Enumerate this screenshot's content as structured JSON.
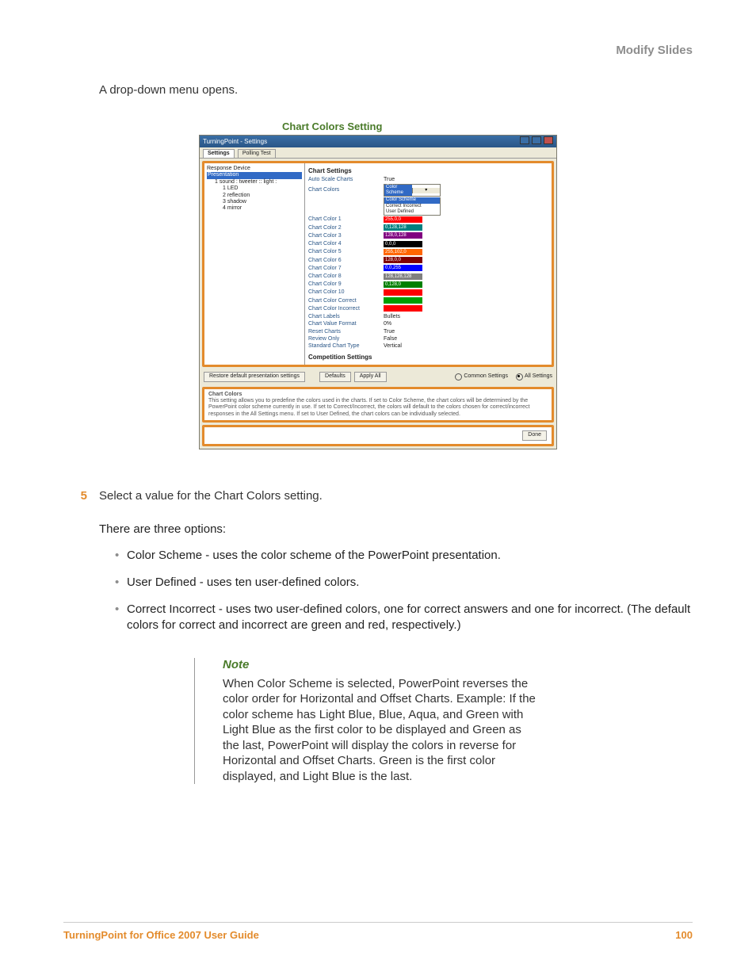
{
  "header": {
    "section": "Modify Slides"
  },
  "intro": "A drop-down menu opens.",
  "caption": "Chart Colors Setting",
  "window": {
    "title": "TurningPoint - Settings",
    "tabs": {
      "settings": "Settings",
      "polling": "Polling Test"
    },
    "tree": {
      "responseDevice": "Response Device",
      "presentation": "Presentation",
      "parent": "1  sound : tweeter :: light :",
      "i1": "1  LED",
      "i2": "2  reflection",
      "i3": "3  shadow",
      "i4": "4  mirror"
    },
    "section1": "Chart Settings",
    "props": {
      "autoScale": {
        "l": "Auto Scale Charts",
        "v": "True"
      },
      "chartColors": {
        "l": "Chart Colors",
        "v": "Color Scheme",
        "opt1": "Color Scheme",
        "opt2": "Correct Incorrect",
        "opt3": "User Defined"
      },
      "c1": {
        "l": "Chart Color 1",
        "v": "255,0,0",
        "bg": "#ff0000"
      },
      "c2": {
        "l": "Chart Color 2",
        "v": "0,128,128",
        "bg": "#008080"
      },
      "c3": {
        "l": "Chart Color 3",
        "v": "128,0,128",
        "bg": "#800080"
      },
      "c4": {
        "l": "Chart Color 4",
        "v": "0,0,0",
        "bg": "#000000"
      },
      "c5": {
        "l": "Chart Color 5",
        "v": "255,102,0",
        "bg": "#ff6600"
      },
      "c6": {
        "l": "Chart Color 6",
        "v": "128,0,0",
        "bg": "#800000"
      },
      "c7": {
        "l": "Chart Color 7",
        "v": "0,0,255",
        "bg": "#0000ff"
      },
      "c8": {
        "l": "Chart Color 8",
        "v": "128,128,128",
        "bg": "#808080"
      },
      "c9": {
        "l": "Chart Color 9",
        "v": "0,128,0",
        "bg": "#008000"
      },
      "c10": {
        "l": "Chart Color 10",
        "v": "",
        "bg": "#ff0000"
      },
      "cc": {
        "l": "Chart Color Correct",
        "v": "",
        "bg": "#00a000"
      },
      "ci": {
        "l": "Chart Color Incorrect",
        "v": "",
        "bg": "#ff0000"
      },
      "labels": {
        "l": "Chart Labels",
        "v": "Bullets"
      },
      "valfmt": {
        "l": "Chart Value Format",
        "v": "0%"
      },
      "reset": {
        "l": "Reset Charts",
        "v": "True"
      },
      "review": {
        "l": "Review Only",
        "v": "False"
      },
      "stdtype": {
        "l": "Standard Chart Type",
        "v": "Vertical"
      }
    },
    "section2": "Competition Settings",
    "buttons": {
      "restore": "Restore default presentation settings",
      "defaults": "Defaults",
      "applyAll": "Apply All",
      "common": "Common Settings",
      "all": "All Settings",
      "done": "Done"
    },
    "help": {
      "title": "Chart Colors",
      "body": "This setting allows you to predefine the colors used in the charts. If set to Color Scheme, the chart colors will be determined by the PowerPoint color scheme currently in use. If set to Correct/Incorrect, the colors will default to the colors chosen for correct/incorrect responses in the All Settings menu. If set to User Defined, the chart colors can be individually selected."
    }
  },
  "step": {
    "num": "5",
    "text": "Select a value for the Chart Colors setting."
  },
  "optsIntro": "There are three options:",
  "opts": {
    "a": "Color Scheme - uses the color scheme of the PowerPoint presentation.",
    "b": "User Defined - uses ten user-defined colors.",
    "c": "Correct Incorrect - uses two user-defined colors, one for correct answers and one for incorrect. (The default colors for correct and incorrect are green and red, respectively.)"
  },
  "note": {
    "title": "Note",
    "body": "When Color Scheme is selected, PowerPoint reverses the color order for Horizontal and Offset Charts. Example: If the color scheme has Light Blue, Blue, Aqua, and Green with Light Blue as the first color to be displayed and Green as the last, PowerPoint will display the colors in reverse for Horizontal and Offset Charts. Green is the first color displayed, and Light Blue is the last."
  },
  "footer": {
    "left": "TurningPoint for Office 2007 User Guide",
    "right": "100"
  }
}
